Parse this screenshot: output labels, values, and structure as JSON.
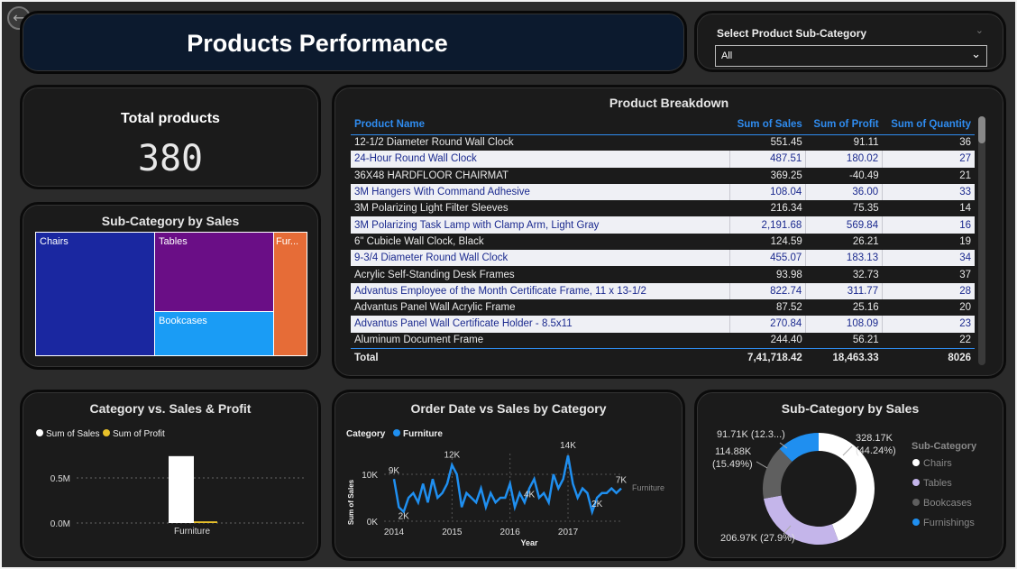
{
  "header": {
    "title": "Products Performance",
    "back_icon": "back-arrow-icon"
  },
  "slicer": {
    "label": "Select Product Sub-Category",
    "value": "All"
  },
  "kpi": {
    "label": "Total products",
    "value": "380"
  },
  "treemap": {
    "title": "Sub-Category by Sales",
    "tiles": [
      {
        "label": "Chairs",
        "color": "#1a27a0"
      },
      {
        "label": "Tables",
        "color": "#6a0e86"
      },
      {
        "label": "Bookcases",
        "color": "#1a9cf5"
      },
      {
        "label": "Fur...",
        "color": "#e66c37"
      }
    ]
  },
  "breakdown": {
    "title": "Product Breakdown",
    "columns": [
      "Product Name",
      "Sum of Sales",
      "Sum of Profit",
      "Sum of Quantity"
    ],
    "rows": [
      [
        "12-1/2 Diameter Round Wall Clock",
        "551.45",
        "91.11",
        "36"
      ],
      [
        "24-Hour Round Wall Clock",
        "487.51",
        "180.02",
        "27"
      ],
      [
        "36X48 HARDFLOOR CHAIRMAT",
        "369.25",
        "-40.49",
        "21"
      ],
      [
        "3M Hangers With Command Adhesive",
        "108.04",
        "36.00",
        "33"
      ],
      [
        "3M Polarizing Light Filter Sleeves",
        "216.34",
        "75.35",
        "14"
      ],
      [
        "3M Polarizing Task Lamp with Clamp Arm, Light Gray",
        "2,191.68",
        "569.84",
        "16"
      ],
      [
        "6\" Cubicle Wall Clock, Black",
        "124.59",
        "26.21",
        "19"
      ],
      [
        "9-3/4 Diameter Round Wall Clock",
        "455.07",
        "183.13",
        "34"
      ],
      [
        "Acrylic Self-Standing Desk Frames",
        "93.98",
        "32.73",
        "37"
      ],
      [
        "Advantus Employee of the Month Certificate Frame, 11 x 13-1/2",
        "822.74",
        "311.77",
        "28"
      ],
      [
        "Advantus Panel Wall Acrylic Frame",
        "87.52",
        "25.16",
        "20"
      ],
      [
        "Advantus Panel Wall Certificate Holder - 8.5x11",
        "270.84",
        "108.09",
        "23"
      ],
      [
        "Aluminum Document Frame",
        "244.40",
        "56.21",
        "22"
      ]
    ],
    "total": [
      "Total",
      "7,41,718.42",
      "18,463.33",
      "8026"
    ]
  },
  "cat_chart": {
    "title": "Category vs. Sales & Profit",
    "legend": [
      {
        "label": "Sum of Sales",
        "color": "#ffffff"
      },
      {
        "label": "Sum of Profit",
        "color": "#e8c12a"
      }
    ],
    "y_ticks": [
      "0.5M",
      "0.0M"
    ],
    "x_label": "Furniture"
  },
  "order_chart": {
    "title": "Order Date vs Sales by Category",
    "legend_title": "Category",
    "legend_item": "Furniture",
    "ylabel": "Sum of Sales",
    "xlabel": "Year",
    "y_ticks": [
      "10K",
      "0K"
    ],
    "x_ticks": [
      "2014",
      "2015",
      "2016",
      "2017"
    ],
    "annotations": [
      "9K",
      "2K",
      "12K",
      "14K",
      "4K",
      "2K",
      "7K"
    ],
    "series_end_label": "Furniture",
    "color": "#1f8ff0"
  },
  "donut": {
    "title": "Sub-Category by Sales",
    "legend_title": "Sub-Category",
    "labels": [
      "91.71K (12.3...)",
      "114.88K",
      "(15.49%)",
      "328.17K",
      "(44.24%)",
      "206.97K (27.9%)"
    ]
  },
  "chart_data": [
    {
      "type": "bar",
      "title": "Category vs. Sales & Profit",
      "categories": [
        "Furniture"
      ],
      "series": [
        {
          "name": "Sum of Sales",
          "values": [
            741718.42
          ]
        },
        {
          "name": "Sum of Profit",
          "values": [
            18463.33
          ]
        }
      ],
      "ylim": [
        0,
        800000
      ]
    },
    {
      "type": "line",
      "title": "Order Date vs Sales by Category",
      "xlabel": "Year",
      "ylabel": "Sum of Sales",
      "series": [
        {
          "name": "Furniture",
          "x": [
            "2014-01",
            "2014-02",
            "2014-03",
            "2014-04",
            "2014-05",
            "2014-06",
            "2014-07",
            "2014-08",
            "2014-09",
            "2014-10",
            "2014-11",
            "2014-12",
            "2015-01",
            "2015-02",
            "2015-03",
            "2015-04",
            "2015-05",
            "2015-06",
            "2015-07",
            "2015-08",
            "2015-09",
            "2015-10",
            "2015-11",
            "2015-12",
            "2016-01",
            "2016-02",
            "2016-03",
            "2016-04",
            "2016-05",
            "2016-06",
            "2016-07",
            "2016-08",
            "2016-09",
            "2016-10",
            "2016-11",
            "2016-12",
            "2017-01",
            "2017-02",
            "2017-03",
            "2017-04",
            "2017-05",
            "2017-06",
            "2017-07",
            "2017-08",
            "2017-09",
            "2017-10",
            "2017-11",
            "2017-12"
          ],
          "y": [
            9,
            3,
            2,
            5,
            6,
            4,
            8,
            4,
            9,
            5,
            6,
            8,
            12,
            10,
            3,
            6,
            5,
            4,
            7,
            3,
            6,
            4,
            5,
            5,
            8,
            3,
            6,
            4,
            7,
            9,
            5,
            6,
            4,
            10,
            7,
            9,
            14,
            8,
            5,
            7,
            6,
            2,
            5,
            6,
            6,
            7,
            6,
            7
          ]
        }
      ],
      "ylim": [
        0,
        15
      ]
    },
    {
      "type": "pie",
      "title": "Sub-Category by Sales",
      "categories": [
        "Chairs",
        "Tables",
        "Bookcases",
        "Furnishings"
      ],
      "values": [
        328.17,
        206.97,
        114.88,
        91.71
      ],
      "colors": [
        "#ffffff",
        "#c4b5ea",
        "#5f5f5f",
        "#1f8ff0"
      ]
    }
  ]
}
